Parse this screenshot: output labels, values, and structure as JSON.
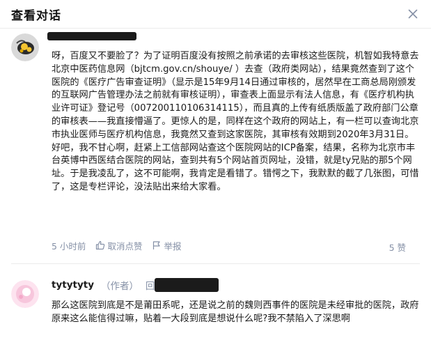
{
  "header": {
    "title": "查看对话"
  },
  "comments": [
    {
      "text": "呀，百度又不要脸了？为了证明百度没有按照之前承诺的去审核这些医院，机智如我特意去北京中医药信息网（bjtcm.gov.cn/shouye/ ）去查（政府类网站），结果竟然查到了这个医院的《医疗广告审查证明》（显示是15年9月14日通过审核的，居然早在工商总局刚颁发的互联网广告管理办法之前就有审核证明），审查表上面显示有法人信息，有《医疗机构执业许可证》登记号（00720011010631411​5），而且真的上传有纸质版盖了政府部门公章的审核表——我直接懵逼了。更惊人的是，同样在这个政府的网站上，有一栏可以查询北京市执业医师与医疗机构信息，我竟然又查到这家医院，其审核有效期到2020年3月31日。好吧，我不甘心啊，赶紧上工信部网站查这个医院网站的ICP备案，结果，名称为北京市丰台英博中西医结合医院的网站，查到共有5个网站首页网址，没错，就是ty兄贴的那5个网址。于是我凌乱了，这不可能啊，我肯定是看错了。错愕之下，我默默的截了几张图，可惜了，这是专栏评论，没法贴出来给大家看。",
      "time": "5 小时前",
      "unlike_label": "取消点赞",
      "report_label": "举报",
      "likes": "5 赞"
    },
    {
      "author": "tytytyty",
      "author_tag": "（作者）",
      "reply_word": "回复",
      "text": "那么这医院到底是不是莆田系呢，还是说之前的魏则西事件的医院是未经审批的医院，政府原来这么能信得过嘛，贴着一大段到底是想说什么呢?我不禁陷入了深思啊"
    }
  ],
  "colors": {
    "muted": "#8590a6",
    "accent": "#0084ff",
    "text": "#1a1a1a"
  },
  "icons": [
    "close-icon",
    "thumbs-up-icon",
    "flag-icon"
  ]
}
